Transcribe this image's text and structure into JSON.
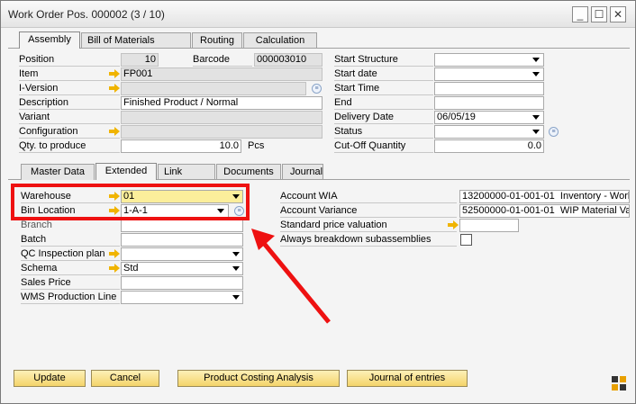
{
  "window": {
    "title": "Work Order Pos. 000002 (3 / 10)",
    "minimize": "_",
    "maximize": "☐",
    "close": "✕"
  },
  "tabs_top": [
    "Assembly",
    "Bill of Materials",
    "Routing",
    "Calculation"
  ],
  "header_left": {
    "position_label": "Position",
    "position_value": "10",
    "barcode_label": "Barcode",
    "barcode_value": "000003010",
    "item_label": "Item",
    "item_value": "FP001",
    "iversion_label": "I-Version",
    "iversion_value": "",
    "description_label": "Description",
    "description_value": "Finished Product / Normal",
    "variant_label": "Variant",
    "variant_value": "",
    "configuration_label": "Configuration",
    "configuration_value": "",
    "qty_label": "Qty. to produce",
    "qty_value": "10.0",
    "qty_unit": "Pcs"
  },
  "header_right": {
    "start_structure_label": "Start Structure",
    "start_structure_value": "",
    "start_date_label": "Start date",
    "start_date_value": "",
    "start_time_label": "Start Time",
    "start_time_value": "",
    "end_label": "End",
    "end_value": "",
    "delivery_date_label": "Delivery Date",
    "delivery_date_value": "06/05/19",
    "status_label": "Status",
    "status_value": "",
    "cutoff_label": "Cut-Off Quantity",
    "cutoff_value": "0.0"
  },
  "tabs_sub": [
    "Master Data",
    "Extended",
    "Link",
    "Documents",
    "Journal"
  ],
  "extended_left": {
    "warehouse_label": "Warehouse",
    "warehouse_value": "01",
    "bin_label": "Bin Location",
    "bin_value": "1-A-1",
    "branch_label": "Branch",
    "branch_value": "",
    "batch_label": "Batch",
    "batch_value": "",
    "qc_label": "QC Inspection plan",
    "qc_value": "",
    "schema_label": "Schema",
    "schema_value": "Std",
    "sales_price_label": "Sales Price",
    "sales_price_value": "",
    "wms_label": "WMS Production Line",
    "wms_value": ""
  },
  "extended_right": {
    "wia_label": "Account WIA",
    "wia_code": "13200000-01-001-01",
    "wia_name": "Inventory - Work",
    "variance_label": "Account Variance",
    "variance_code": "52500000-01-001-01",
    "variance_name": "WIP Material Varia",
    "std_price_label": "Standard price valuation",
    "std_price_value": "",
    "always_breakdown_label": "Always breakdown subassemblies"
  },
  "buttons": {
    "update": "Update",
    "cancel": "Cancel",
    "costing": "Product Costing Analysis",
    "journal": "Journal of entries"
  },
  "colors": {
    "highlight": "#e11111",
    "field_yellow": "#fbee9b",
    "button": "#f4d46a"
  }
}
